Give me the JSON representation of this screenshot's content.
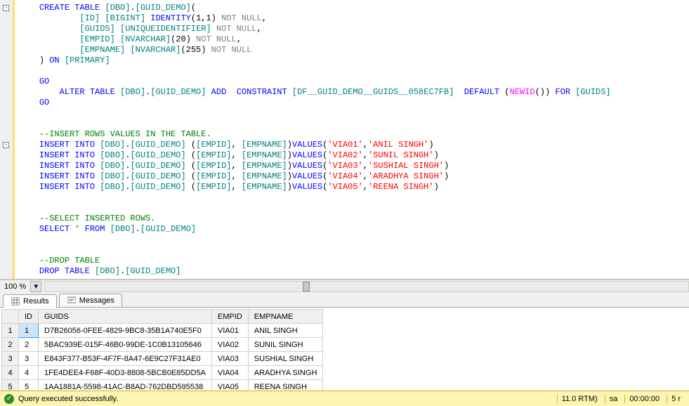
{
  "editor": {
    "zoom": "100 %",
    "lines": [
      {
        "ind": 1,
        "tokens": [
          {
            "t": "CREATE TABLE",
            "c": "kw"
          },
          {
            "t": " "
          },
          {
            "t": "[DBO]",
            "c": "obj"
          },
          {
            "t": "."
          },
          {
            "t": "[GUID_DEMO]",
            "c": "obj"
          },
          {
            "t": "("
          }
        ]
      },
      {
        "ind": 3,
        "tokens": [
          {
            "t": "[ID]",
            "c": "obj"
          },
          {
            "t": " "
          },
          {
            "t": "[BIGINT]",
            "c": "obj"
          },
          {
            "t": " "
          },
          {
            "t": "IDENTITY",
            "c": "kw"
          },
          {
            "t": "("
          },
          {
            "t": "1",
            "c": "num"
          },
          {
            "t": ","
          },
          {
            "t": "1",
            "c": "num"
          },
          {
            "t": ")"
          },
          {
            "t": " "
          },
          {
            "t": "NOT NULL",
            "c": "gray"
          },
          {
            "t": ","
          }
        ]
      },
      {
        "ind": 3,
        "tokens": [
          {
            "t": "[GUIDS]",
            "c": "obj"
          },
          {
            "t": " "
          },
          {
            "t": "[UNIQUEIDENTIFIER]",
            "c": "obj"
          },
          {
            "t": " "
          },
          {
            "t": "NOT NULL",
            "c": "gray"
          },
          {
            "t": ","
          }
        ]
      },
      {
        "ind": 3,
        "tokens": [
          {
            "t": "[EMPID]",
            "c": "obj"
          },
          {
            "t": " "
          },
          {
            "t": "[NVARCHAR]",
            "c": "obj"
          },
          {
            "t": "("
          },
          {
            "t": "20",
            "c": "num"
          },
          {
            "t": ")"
          },
          {
            "t": " "
          },
          {
            "t": "NOT NULL",
            "c": "gray"
          },
          {
            "t": ","
          }
        ]
      },
      {
        "ind": 3,
        "tokens": [
          {
            "t": "[EMPNAME]",
            "c": "obj"
          },
          {
            "t": " "
          },
          {
            "t": "[NVARCHAR]",
            "c": "obj"
          },
          {
            "t": "("
          },
          {
            "t": "255",
            "c": "num"
          },
          {
            "t": ")"
          },
          {
            "t": " "
          },
          {
            "t": "NOT NULL",
            "c": "gray"
          }
        ]
      },
      {
        "ind": 1,
        "tokens": [
          {
            "t": ")"
          },
          {
            "t": " "
          },
          {
            "t": "ON",
            "c": "kw"
          },
          {
            "t": " "
          },
          {
            "t": "[PRIMARY]",
            "c": "obj"
          }
        ]
      },
      {
        "ind": 0,
        "tokens": []
      },
      {
        "ind": 1,
        "tokens": [
          {
            "t": "GO",
            "c": "kw"
          }
        ]
      },
      {
        "ind": 2,
        "tokens": [
          {
            "t": "ALTER TABLE",
            "c": "kw"
          },
          {
            "t": " "
          },
          {
            "t": "[DBO]",
            "c": "obj"
          },
          {
            "t": "."
          },
          {
            "t": "[GUID_DEMO]",
            "c": "obj"
          },
          {
            "t": " "
          },
          {
            "t": "ADD",
            "c": "kw"
          },
          {
            "t": "  "
          },
          {
            "t": "CONSTRAINT",
            "c": "kw"
          },
          {
            "t": " "
          },
          {
            "t": "[DF__GUID_DEMO__GUIDS__058EC7FB]",
            "c": "obj"
          },
          {
            "t": "  "
          },
          {
            "t": "DEFAULT",
            "c": "kw"
          },
          {
            "t": " ("
          },
          {
            "t": "NEWID",
            "c": "fn"
          },
          {
            "t": "())"
          },
          {
            "t": " "
          },
          {
            "t": "FOR",
            "c": "kw"
          },
          {
            "t": " "
          },
          {
            "t": "[GUIDS]",
            "c": "obj"
          }
        ]
      },
      {
        "ind": 1,
        "tokens": [
          {
            "t": "GO",
            "c": "kw"
          }
        ]
      },
      {
        "ind": 0,
        "tokens": []
      },
      {
        "ind": 0,
        "tokens": []
      },
      {
        "ind": 1,
        "tokens": [
          {
            "t": "--INSERT ROWS VALUES IN THE TABLE.",
            "c": "cmt"
          }
        ]
      },
      {
        "ind": 1,
        "tokens": [
          {
            "t": "INSERT INTO",
            "c": "kw"
          },
          {
            "t": " "
          },
          {
            "t": "[DBO]",
            "c": "obj"
          },
          {
            "t": "."
          },
          {
            "t": "[GUID_DEMO]",
            "c": "obj"
          },
          {
            "t": " ("
          },
          {
            "t": "[EMPID]",
            "c": "obj"
          },
          {
            "t": ", "
          },
          {
            "t": "[EMPNAME]",
            "c": "obj"
          },
          {
            "t": ")"
          },
          {
            "t": "VALUES",
            "c": "kw"
          },
          {
            "t": "("
          },
          {
            "t": "'VIA01'",
            "c": "str"
          },
          {
            "t": ","
          },
          {
            "t": "'ANIL SINGH'",
            "c": "str"
          },
          {
            "t": ")"
          }
        ]
      },
      {
        "ind": 1,
        "tokens": [
          {
            "t": "INSERT INTO",
            "c": "kw"
          },
          {
            "t": " "
          },
          {
            "t": "[DBO]",
            "c": "obj"
          },
          {
            "t": "."
          },
          {
            "t": "[GUID_DEMO]",
            "c": "obj"
          },
          {
            "t": " ("
          },
          {
            "t": "[EMPID]",
            "c": "obj"
          },
          {
            "t": ", "
          },
          {
            "t": "[EMPNAME]",
            "c": "obj"
          },
          {
            "t": ")"
          },
          {
            "t": "VALUES",
            "c": "kw"
          },
          {
            "t": "("
          },
          {
            "t": "'VIA02'",
            "c": "str"
          },
          {
            "t": ","
          },
          {
            "t": "'SUNIL SINGH'",
            "c": "str"
          },
          {
            "t": ")"
          }
        ]
      },
      {
        "ind": 1,
        "tokens": [
          {
            "t": "INSERT INTO",
            "c": "kw"
          },
          {
            "t": " "
          },
          {
            "t": "[DBO]",
            "c": "obj"
          },
          {
            "t": "."
          },
          {
            "t": "[GUID_DEMO]",
            "c": "obj"
          },
          {
            "t": " ("
          },
          {
            "t": "[EMPID]",
            "c": "obj"
          },
          {
            "t": ", "
          },
          {
            "t": "[EMPNAME]",
            "c": "obj"
          },
          {
            "t": ")"
          },
          {
            "t": "VALUES",
            "c": "kw"
          },
          {
            "t": "("
          },
          {
            "t": "'VIA03'",
            "c": "str"
          },
          {
            "t": ","
          },
          {
            "t": "'SUSHIAL SINGH'",
            "c": "str"
          },
          {
            "t": ")"
          }
        ]
      },
      {
        "ind": 1,
        "tokens": [
          {
            "t": "INSERT INTO",
            "c": "kw"
          },
          {
            "t": " "
          },
          {
            "t": "[DBO]",
            "c": "obj"
          },
          {
            "t": "."
          },
          {
            "t": "[GUID_DEMO]",
            "c": "obj"
          },
          {
            "t": " ("
          },
          {
            "t": "[EMPID]",
            "c": "obj"
          },
          {
            "t": ", "
          },
          {
            "t": "[EMPNAME]",
            "c": "obj"
          },
          {
            "t": ")"
          },
          {
            "t": "VALUES",
            "c": "kw"
          },
          {
            "t": "("
          },
          {
            "t": "'VIA04'",
            "c": "str"
          },
          {
            "t": ","
          },
          {
            "t": "'ARADHYA SINGH'",
            "c": "str"
          },
          {
            "t": ")"
          }
        ]
      },
      {
        "ind": 1,
        "tokens": [
          {
            "t": "INSERT INTO",
            "c": "kw"
          },
          {
            "t": " "
          },
          {
            "t": "[DBO]",
            "c": "obj"
          },
          {
            "t": "."
          },
          {
            "t": "[GUID_DEMO]",
            "c": "obj"
          },
          {
            "t": " ("
          },
          {
            "t": "[EMPID]",
            "c": "obj"
          },
          {
            "t": ", "
          },
          {
            "t": "[EMPNAME]",
            "c": "obj"
          },
          {
            "t": ")"
          },
          {
            "t": "VALUES",
            "c": "kw"
          },
          {
            "t": "("
          },
          {
            "t": "'VIA05'",
            "c": "str"
          },
          {
            "t": ","
          },
          {
            "t": "'REENA SINGH'",
            "c": "str"
          },
          {
            "t": ")"
          }
        ]
      },
      {
        "ind": 0,
        "tokens": []
      },
      {
        "ind": 0,
        "tokens": []
      },
      {
        "ind": 1,
        "tokens": [
          {
            "t": "--SELECT INSERTED ROWS.",
            "c": "cmt"
          }
        ]
      },
      {
        "ind": 1,
        "tokens": [
          {
            "t": "SELECT",
            "c": "kw"
          },
          {
            "t": " "
          },
          {
            "t": "*",
            "c": "star"
          },
          {
            "t": " "
          },
          {
            "t": "FROM",
            "c": "kw"
          },
          {
            "t": " "
          },
          {
            "t": "[DBO]",
            "c": "obj"
          },
          {
            "t": "."
          },
          {
            "t": "[GUID_DEMO]",
            "c": "obj"
          }
        ]
      },
      {
        "ind": 0,
        "tokens": []
      },
      {
        "ind": 0,
        "tokens": []
      },
      {
        "ind": 1,
        "tokens": [
          {
            "t": "--DROP TABLE",
            "c": "cmt"
          }
        ]
      },
      {
        "ind": 1,
        "tokens": [
          {
            "t": "DROP TABLE",
            "c": "kw"
          },
          {
            "t": " "
          },
          {
            "t": "[DBO]",
            "c": "obj"
          },
          {
            "t": "."
          },
          {
            "t": "[GUID_DEMO]",
            "c": "obj"
          }
        ]
      }
    ],
    "folds": [
      0,
      13
    ]
  },
  "tabs": {
    "results": "Results",
    "messages": "Messages"
  },
  "results": {
    "headers": [
      "",
      "ID",
      "GUIDS",
      "EMPID",
      "EMPNAME"
    ],
    "rows": [
      [
        "1",
        "1",
        "D7B26056-0FEE-4829-9BC8-35B1A740E5F0",
        "VIA01",
        "ANIL SINGH"
      ],
      [
        "2",
        "2",
        "5BAC939E-015F-46B0-99DE-1C0B13105646",
        "VIA02",
        "SUNIL SINGH"
      ],
      [
        "3",
        "3",
        "E843F377-B53F-4F7F-8A47-6E9C27F31AE0",
        "VIA03",
        "SUSHIAL SINGH"
      ],
      [
        "4",
        "4",
        "1FE4DEE4-F68F-40D3-8808-5BCB0E85DD5A",
        "VIA04",
        "ARADHYA SINGH"
      ],
      [
        "5",
        "5",
        "1AA1881A-5598-41AC-B8AD-762DBD595538",
        "VIA05",
        "REENA SINGH"
      ]
    ]
  },
  "status": {
    "message": "Query executed successfully.",
    "server": "11.0 RTM)",
    "user": "sa",
    "time": "00:00:00",
    "rows": "5 r"
  }
}
